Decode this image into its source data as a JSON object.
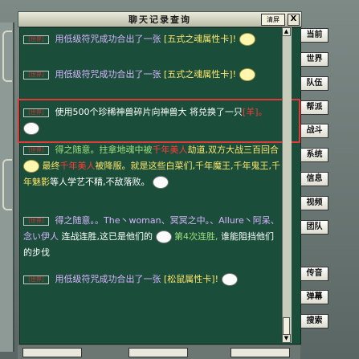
{
  "window": {
    "title": "聊天记录查询",
    "clear_label": "清屏",
    "close_label": "X"
  },
  "sidebar": {
    "buttons": [
      {
        "label": "当前"
      },
      {
        "label": "世界"
      },
      {
        "label": "队伍"
      },
      {
        "label": "帮派"
      },
      {
        "label": "战斗"
      },
      {
        "label": "系统"
      },
      {
        "label": "信息"
      },
      {
        "label": "视频"
      },
      {
        "label": "团队"
      },
      {
        "label": "传音"
      },
      {
        "label": "弹幕"
      },
      {
        "label": "搜索"
      }
    ]
  },
  "messages": [
    {
      "tag": "[世界]",
      "sender": "",
      "text1": "用低级符咒成功合出了一张",
      "text2": "[五式之魂属性卡]",
      "text3": "!"
    },
    {
      "tag": "[世界]",
      "sender": "",
      "text1": "用低级符咒成功合出了一张",
      "text2": "[五",
      "text3": "式之魂属性卡]!"
    },
    {
      "tag": "[世界]",
      "sender": "",
      "text1": "使用500个珍稀神兽碎片向神兽大",
      "text2": "将兑换了一只",
      "text3": "[羊]。"
    },
    {
      "tag": "[世界]",
      "text1": "得之随意。拄拿地魂中被",
      "text2": "千年美人",
      "text3": "劫道,双方大战三百回合",
      "text4": "最终",
      "text5": "千年美人",
      "text6": "被降服。就是这些白菜们,千年魔王,千年鬼王,千年魅影",
      "text7": "等人学艺不精,不敌落败。"
    },
    {
      "tag": "[世界]",
      "text1": "得之随意。。The丶woman、冥冥之中。、Allure丶阿呆、念い伊人",
      "text2": "连战连胜,这已是他们的",
      "text3": "第4次连胜,",
      "text4": "谁能阻挡他们的步伐"
    },
    {
      "tag": "[世界]",
      "sender": "",
      "text1": "用低级符咒成功合出了一张",
      "text2": "[松",
      "text3": "鼠属性卡]!"
    }
  ]
}
